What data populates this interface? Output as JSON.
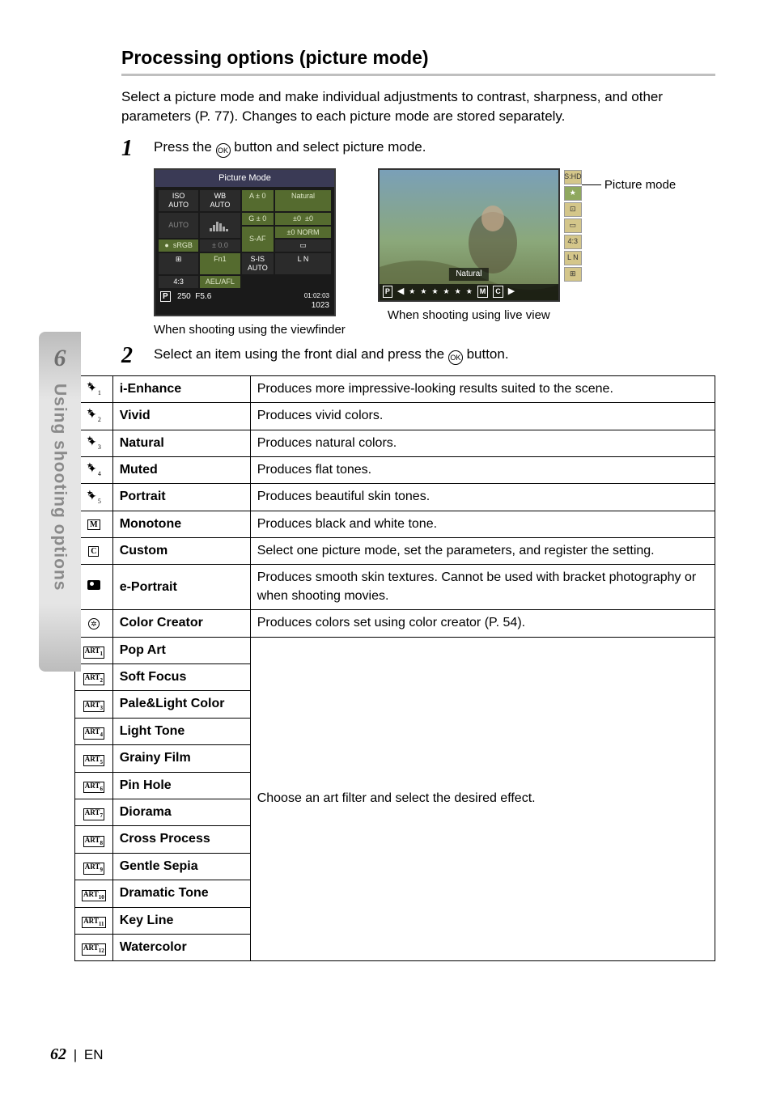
{
  "section": {
    "title": "Processing options (picture mode)",
    "intro": "Select a picture mode and make individual adjustments to contrast, sharpness, and other parameters (P. 77). Changes to each picture mode are stored separately."
  },
  "steps": {
    "s1_num": "1",
    "s1_text_a": "Press the ",
    "s1_text_b": " button and select picture mode.",
    "s2_num": "2",
    "s2_text_a": "Select an item using the front dial and press the ",
    "s2_text_b": " button.",
    "ok_label": "OK"
  },
  "lcd": {
    "header": "Picture Mode",
    "cells": {
      "iso": "ISO\nAUTO",
      "wb": "WB\nAUTO",
      "a0": "A ± 0",
      "g0": "G ± 0",
      "natural": "Natural",
      "s0": "±0",
      "r0": "±0",
      "flash": "AUTO",
      "hist": "",
      "saf": "S-AF",
      "hq0": "±0",
      "norm": "NORM",
      "dot": "●",
      "srgb": "sRGB",
      "ev": "± 0.0",
      "rect": "▭",
      "grid": "⊞",
      "fn": "Fn1",
      "sis": "S-IS AUTO",
      "ln": "L N",
      "ratio": "4:3",
      "ael": "AEL/AFL"
    },
    "footer": {
      "p": "P",
      "shutter": "250",
      "fnum": "F5.6",
      "time": "01:02:03",
      "shots": "1023"
    }
  },
  "live": {
    "p": "P",
    "tag": "Natural",
    "strip_items": [
      "★",
      "★",
      "★",
      "★",
      "★",
      "★",
      "M",
      "C",
      "▶"
    ],
    "side_items": [
      "S:HD",
      "★",
      "⊡",
      "▭",
      "4:3",
      "L N",
      "⊞"
    ]
  },
  "captions": {
    "viewfinder": "When shooting using the viewfinder",
    "liveview": "When shooting using live view",
    "leader": "Picture mode"
  },
  "table": [
    {
      "name": "i-Enhance",
      "desc": "Produces more impressive-looking results suited to the scene."
    },
    {
      "name": "Vivid",
      "desc": "Produces vivid colors."
    },
    {
      "name": "Natural",
      "desc": "Produces natural colors."
    },
    {
      "name": "Muted",
      "desc": "Produces flat tones."
    },
    {
      "name": "Portrait",
      "desc": "Produces beautiful skin tones."
    },
    {
      "name": "Monotone",
      "desc": "Produces black and white tone."
    },
    {
      "name": "Custom",
      "desc": "Select one picture mode, set the parameters, and register the setting."
    },
    {
      "name": "e-Portrait",
      "desc": "Produces smooth skin textures. Cannot be used with bracket photography or when shooting movies."
    },
    {
      "name": "Color Creator",
      "desc": "Produces colors set using color creator (P. 54)."
    },
    {
      "name": "Pop Art"
    },
    {
      "name": "Soft Focus"
    },
    {
      "name": "Pale&Light Color"
    },
    {
      "name": "Light Tone"
    },
    {
      "name": "Grainy Film"
    },
    {
      "name": "Pin Hole"
    },
    {
      "name": "Diorama"
    },
    {
      "name": "Cross Process"
    },
    {
      "name": "Gentle Sepia"
    },
    {
      "name": "Dramatic Tone"
    },
    {
      "name": "Key Line"
    },
    {
      "name": "Watercolor"
    }
  ],
  "art_desc": "Choose an art filter and select the desired effect.",
  "sidebar": {
    "chapter": "6",
    "label": "Using shooting options"
  },
  "footer": {
    "page": "62",
    "lang": "EN"
  }
}
